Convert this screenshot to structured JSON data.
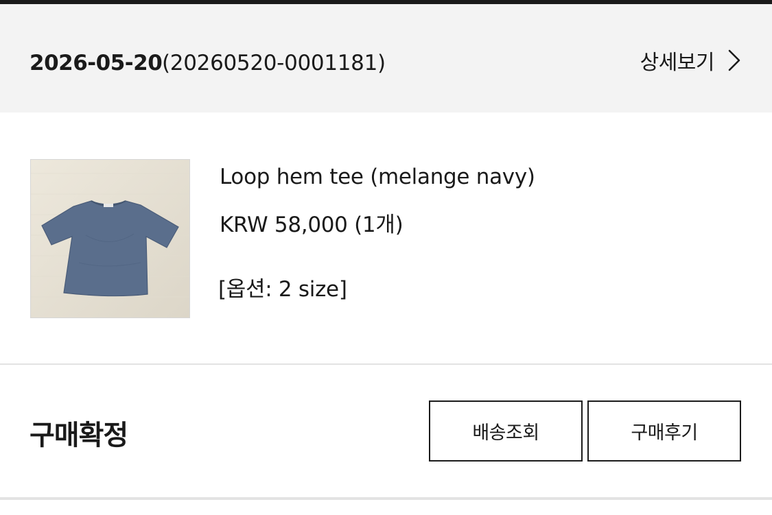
{
  "order": {
    "date": "2026-05-20",
    "number": "(20260520-0001181)",
    "detail_label": "상세보기",
    "detail_icon": "chevron-right-icon"
  },
  "product": {
    "image_alt": "Loop hem tee navy t-shirt photo",
    "name": "Loop hem tee (melange navy)",
    "price": "KRW 58,000 (1개)",
    "option": "[옵션: 2 size]"
  },
  "status": {
    "label": "구매확정"
  },
  "actions": {
    "track_label": "배송조회",
    "review_label": "구매후기"
  },
  "colors": {
    "header_bg": "#f3f3f3",
    "text": "#1a1a1a",
    "divider": "#e3e3e3",
    "shirt": "#5a6e8c"
  }
}
